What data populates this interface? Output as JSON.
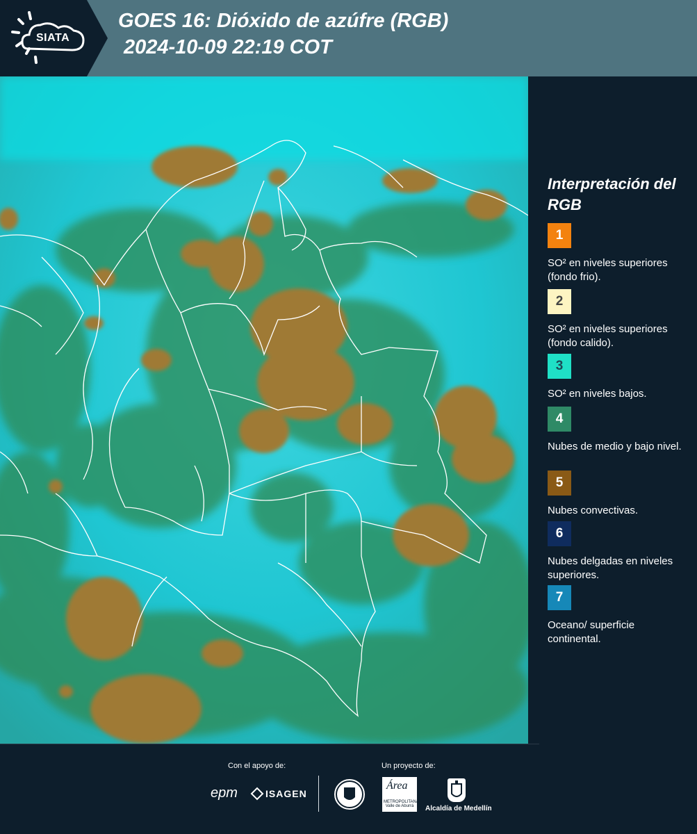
{
  "header": {
    "title_line1": "GOES 16: Dióxido de azúfre (RGB)",
    "title_line2": "2024-10-09 22:19 COT",
    "logo_text": "SIATA",
    "background_color": "#4f7480"
  },
  "map": {
    "description_icon": "satellite-rgb-image",
    "colors": {
      "surface": "#1fd0dd",
      "convective_cloud": "#9f7a35",
      "mid_low_cloud": "#2f8a55",
      "border": "#ffffff"
    }
  },
  "legend": {
    "title": "Interpretación del RGB",
    "items": [
      {
        "number": "1",
        "label": "SO² en niveles superiores (fondo frio).",
        "color": "#f3820f",
        "number_color": "#ffffff"
      },
      {
        "number": "2",
        "label": "SO² en niveles superiores (fondo calido).",
        "color": "#fdf4c2",
        "number_color": "#444444"
      },
      {
        "number": "3",
        "label": "SO² en niveles bajos.",
        "color": "#1fe0c6",
        "number_color": "#1d4a57"
      },
      {
        "number": "4",
        "label": "Nubes de medio y bajo nivel.",
        "color": "#2f8a66",
        "number_color": "#ffffff"
      },
      {
        "number": "5",
        "label": "Nubes convectivas.",
        "color": "#8a5a16",
        "number_color": "#ffffff"
      },
      {
        "number": "6",
        "label": "Nubes delgadas en niveles superiores.",
        "color": "#0f2c5e",
        "number_color": "#ffffff"
      },
      {
        "number": "7",
        "label": "Oceano/ superficie continental.",
        "color": "#1688b8",
        "number_color": "#ffffff"
      }
    ]
  },
  "footer": {
    "support_label": "Con el apoyo de:",
    "project_label": "Un proyecto de:",
    "sponsor_epm": "epm",
    "sponsor_isagen": "ISAGEN",
    "area_word": "Área",
    "area_sub": "METROPOLITANA Valle de Aburrá",
    "alcaldia": "Alcaldía de Medellín"
  }
}
